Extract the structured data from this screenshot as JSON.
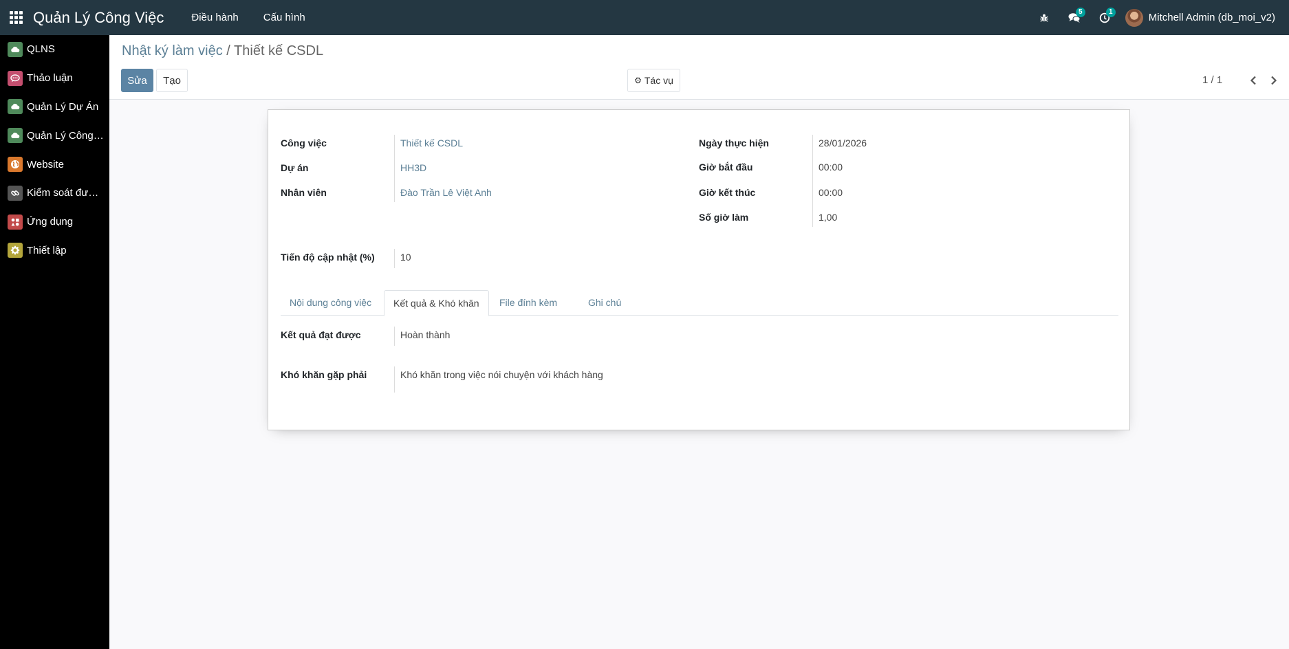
{
  "topbar": {
    "app_title": "Quản Lý Công Việc",
    "menus": [
      "Điều hành",
      "Cấu hình"
    ],
    "messages_badge": "5",
    "activities_badge": "1",
    "user_name": "Mitchell Admin (db_moi_v2)"
  },
  "sidebar": {
    "items": [
      {
        "label": "QLNS",
        "icon": "cloud-icon",
        "color": "#4f8a5b"
      },
      {
        "label": "Thảo luận",
        "icon": "chat-icon",
        "color": "#c44f6f"
      },
      {
        "label": "Quản Lý Dự Án",
        "icon": "cloud-icon",
        "color": "#4f8a5b"
      },
      {
        "label": "Quản Lý Công Việc",
        "icon": "cloud-icon",
        "color": "#4f8a5b"
      },
      {
        "label": "Website",
        "icon": "globe-icon",
        "color": "#d9782d"
      },
      {
        "label": "Kiểm soát đường dẫn",
        "icon": "link-icon",
        "color": "#555555"
      },
      {
        "label": "Ứng dụng",
        "icon": "apps-icon",
        "color": "#c24a4a"
      },
      {
        "label": "Thiết lập",
        "icon": "gear-icon",
        "color": "#b3a53b"
      }
    ]
  },
  "control": {
    "breadcrumb_parent": "Nhật ký làm việc",
    "breadcrumb_separator": " / ",
    "breadcrumb_current": "Thiết kế CSDL",
    "edit_label": "Sửa",
    "create_label": "Tạo",
    "action_label": "Tác vụ",
    "pager": "1 / 1"
  },
  "form": {
    "cong_viec_label": "Công việc",
    "cong_viec_value": "Thiết kế CSDL",
    "du_an_label": "Dự án",
    "du_an_value": "HH3D",
    "nhan_vien_label": "Nhân viên",
    "nhan_vien_value": "Đào Trần Lê Việt Anh",
    "ngay_label": "Ngày thực hiện",
    "ngay_value": "28/01/2026",
    "gio_bd_label": "Giờ bắt đầu",
    "gio_bd_value": "00:00",
    "gio_kt_label": "Giờ kết thúc",
    "gio_kt_value": "00:00",
    "so_gio_label": "Số giờ làm",
    "so_gio_value": "1,00",
    "tien_do_label": "Tiến độ cập nhật (%)",
    "tien_do_value": "10",
    "tabs": [
      "Nội dung công việc",
      "Kết quả & Khó khăn",
      "File đính kèm",
      "Ghi chú"
    ],
    "ket_qua_label": "Kết quả đạt được",
    "ket_qua_value": "Hoàn thành",
    "kho_khan_label": "Khó khăn gặp phải",
    "kho_khan_value": "Khó khăn trong việc nói chuyện với khách hàng"
  }
}
